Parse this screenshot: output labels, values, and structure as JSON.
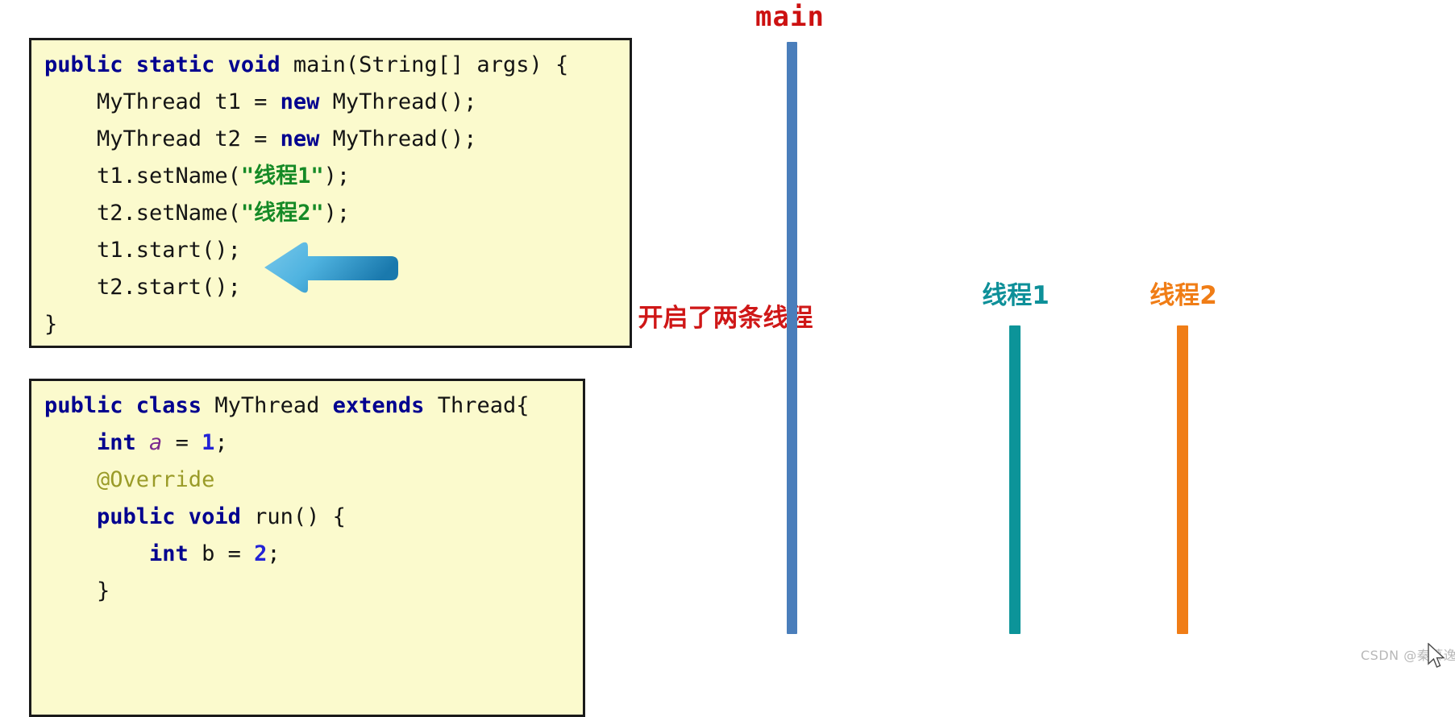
{
  "code_blocks": [
    {
      "name": "main-method",
      "lines": [
        [
          {
            "t": "public static void ",
            "c": "kw"
          },
          {
            "t": "main(String[] args) {",
            "c": "plain"
          }
        ],
        [
          {
            "t": "    MyThread t1 = ",
            "c": "plain"
          },
          {
            "t": "new ",
            "c": "kw"
          },
          {
            "t": "MyThread();",
            "c": "plain"
          }
        ],
        [
          {
            "t": "    MyThread t2 = ",
            "c": "plain"
          },
          {
            "t": "new ",
            "c": "kw"
          },
          {
            "t": "MyThread();",
            "c": "plain"
          }
        ],
        [
          {
            "t": "    t1.setName(",
            "c": "plain"
          },
          {
            "t": "\"线程1\"",
            "c": "str"
          },
          {
            "t": ");",
            "c": "plain"
          }
        ],
        [
          {
            "t": "    t2.setName(",
            "c": "plain"
          },
          {
            "t": "\"线程2\"",
            "c": "str"
          },
          {
            "t": ");",
            "c": "plain"
          }
        ],
        [
          {
            "t": "    t1.start();",
            "c": "plain"
          }
        ],
        [
          {
            "t": "    t2.start();",
            "c": "plain"
          }
        ],
        [
          {
            "t": "}",
            "c": "plain"
          }
        ]
      ]
    },
    {
      "name": "mythread-class",
      "lines": [
        [
          {
            "t": "public class ",
            "c": "kw"
          },
          {
            "t": "MyThread ",
            "c": "plain"
          },
          {
            "t": "extends ",
            "c": "kw"
          },
          {
            "t": "Thread{",
            "c": "plain"
          }
        ],
        [
          {
            "t": "    int ",
            "c": "kw"
          },
          {
            "t": "a",
            "c": "fld"
          },
          {
            "t": " = ",
            "c": "plain"
          },
          {
            "t": "1",
            "c": "num"
          },
          {
            "t": ";",
            "c": "plain"
          }
        ],
        [
          {
            "t": "    @Override",
            "c": "ann"
          }
        ],
        [
          {
            "t": "    public void ",
            "c": "kw"
          },
          {
            "t": "run() {",
            "c": "plain"
          }
        ],
        [
          {
            "t": "        int ",
            "c": "kw"
          },
          {
            "t": "b = ",
            "c": "plain"
          },
          {
            "t": "2",
            "c": "num"
          },
          {
            "t": ";",
            "c": "plain"
          }
        ],
        [
          {
            "t": "    }",
            "c": "plain"
          }
        ]
      ]
    }
  ],
  "annotation": {
    "arrow_label": "start-arrow-pointing-at-t1-start",
    "note": "开启了两条线程"
  },
  "diagram": {
    "threads": [
      {
        "id": "main",
        "label": "main",
        "color": "#4a7ebb",
        "label_color": "#cc1111"
      },
      {
        "id": "thread1",
        "label": "线程1",
        "color": "#0c9499",
        "label_color": "#0e9099"
      },
      {
        "id": "thread2",
        "label": "线程2",
        "color": "#f07d16",
        "label_color": "#f07d16"
      }
    ]
  },
  "watermark": {
    "text": "CSDN @秦慕逸"
  }
}
